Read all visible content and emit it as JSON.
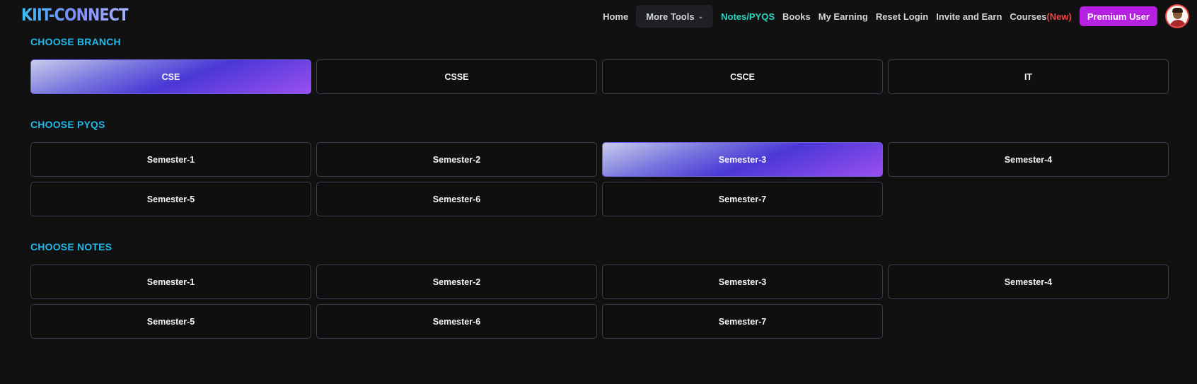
{
  "header": {
    "logo": "KIIT-CONNECT",
    "nav": {
      "home": "Home",
      "more_tools": "More Tools",
      "notes_pyqs": "Notes/PYQS",
      "books": "Books",
      "my_earning": "My Earning",
      "reset_login": "Reset Login",
      "invite_earn": "Invite and Earn",
      "courses": "Courses",
      "courses_badge": "(New)",
      "premium": "Premium User"
    }
  },
  "branch": {
    "title": "CHOOSE BRANCH",
    "options": [
      "CSE",
      "CSSE",
      "CSCE",
      "IT"
    ],
    "selected": "CSE"
  },
  "pyqs": {
    "title": "CHOOSE PYQS",
    "options": [
      "Semester-1",
      "Semester-2",
      "Semester-3",
      "Semester-4",
      "Semester-5",
      "Semester-6",
      "Semester-7"
    ],
    "selected": "Semester-3"
  },
  "notes": {
    "title": "CHOOSE NOTES",
    "options": [
      "Semester-1",
      "Semester-2",
      "Semester-3",
      "Semester-4",
      "Semester-5",
      "Semester-6",
      "Semester-7"
    ]
  },
  "colors": {
    "accent_title": "#22b8e8",
    "active_nav": "#2dd4bf",
    "premium": "#b620e0",
    "new_badge": "#ef4444"
  }
}
